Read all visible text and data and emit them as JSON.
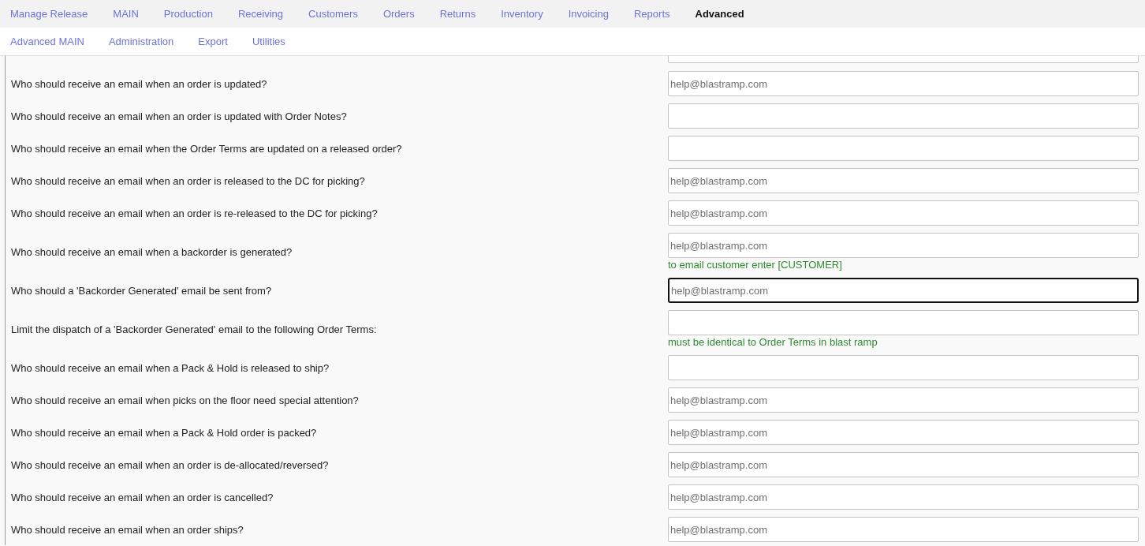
{
  "main_nav": [
    {
      "label": "Manage Release",
      "selected": false
    },
    {
      "label": "MAIN",
      "selected": false
    },
    {
      "label": "Production",
      "selected": false
    },
    {
      "label": "Receiving",
      "selected": false
    },
    {
      "label": "Customers",
      "selected": false
    },
    {
      "label": "Orders",
      "selected": false
    },
    {
      "label": "Returns",
      "selected": false
    },
    {
      "label": "Inventory",
      "selected": false
    },
    {
      "label": "Invoicing",
      "selected": false
    },
    {
      "label": "Reports",
      "selected": false
    },
    {
      "label": "Advanced",
      "selected": true
    }
  ],
  "sub_nav": [
    {
      "label": "Advanced MAIN"
    },
    {
      "label": "Administration"
    },
    {
      "label": "Export"
    },
    {
      "label": "Utilities"
    }
  ],
  "settings": [
    {
      "kind": "cut",
      "focused": false
    },
    {
      "kind": "field",
      "question": "Who should receive an email when an order is updated?",
      "placeholder": "help@blastramp.com",
      "focused": false
    },
    {
      "kind": "field",
      "question": "Who should receive an email when an order is updated with Order Notes?",
      "focused": false
    },
    {
      "kind": "field",
      "question": "Who should receive an email when the Order Terms are updated on a released order?",
      "focused": false
    },
    {
      "kind": "field",
      "question": "Who should receive an email when an order is released to the DC for picking?",
      "placeholder": "help@blastramp.com",
      "focused": false
    },
    {
      "kind": "field",
      "question": "Who should receive an email when an order is re-released to the DC for picking?",
      "placeholder": "help@blastramp.com",
      "focused": false
    },
    {
      "kind": "field",
      "question": "Who should receive an email when a backorder is generated?",
      "placeholder": "help@blastramp.com",
      "hint": "to email customer enter [CUSTOMER]",
      "focused": false
    },
    {
      "kind": "field",
      "question": "Who should a 'Backorder Generated' email be sent from?",
      "placeholder": "help@blastramp.com",
      "focused": true
    },
    {
      "kind": "field",
      "question": "Limit the dispatch of a 'Backorder Generated' email to the following Order Terms:",
      "hint": "must be identical to Order Terms in blast ramp",
      "focused": false
    },
    {
      "kind": "field",
      "question": "Who should receive an email when a Pack & Hold is released to ship?",
      "focused": false
    },
    {
      "kind": "field",
      "question": "Who should receive an email when picks on the floor need special attention?",
      "placeholder": "help@blastramp.com",
      "focused": false
    },
    {
      "kind": "field",
      "question": "Who should receive an email when a Pack & Hold order is packed?",
      "placeholder": "help@blastramp.com",
      "focused": false
    },
    {
      "kind": "field",
      "question": "Who should receive an email when an order is de-allocated/reversed?",
      "placeholder": "help@blastramp.com",
      "focused": false
    },
    {
      "kind": "field",
      "question": "Who should receive an email when an order is cancelled?",
      "placeholder": "help@blastramp.com",
      "focused": false
    },
    {
      "kind": "field",
      "question": "Who should receive an email when an order ships?",
      "placeholder": "help@blastramp.com",
      "focused": false
    }
  ]
}
